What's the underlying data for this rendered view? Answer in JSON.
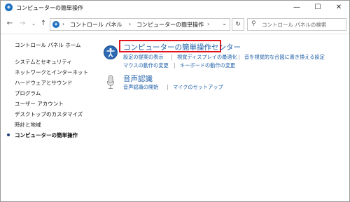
{
  "window": {
    "title": "コンピューターの簡単操作"
  },
  "addressbar": {
    "crumbs": [
      "コントロール パネル",
      "コンピューターの簡単操作"
    ]
  },
  "search": {
    "placeholder": "コントロール パネルの検索"
  },
  "sidebar": {
    "home": "コントロール パネル ホーム",
    "items": [
      {
        "label": "システムとセキュリティ"
      },
      {
        "label": "ネットワークとインターネット"
      },
      {
        "label": "ハードウェアとサウンド"
      },
      {
        "label": "プログラム"
      },
      {
        "label": "ユーザー アカウント"
      },
      {
        "label": "デスクトップのカスタマイズ"
      },
      {
        "label": "時計と地域"
      },
      {
        "label": "コンピューターの簡単操作"
      }
    ]
  },
  "main": {
    "ease": {
      "title": "コンピューターの簡単操作センター",
      "links": [
        "設定の提案の表示",
        "視覚ディスプレイの最適化",
        "音を視覚的な合図に置き換える設定",
        "マウスの動作の変更",
        "キーボードの動作の変更"
      ]
    },
    "speech": {
      "title": "音声認識",
      "links": [
        "音声認識の開始",
        "マイクのセットアップ"
      ]
    }
  },
  "colors": {
    "link": "#1f5fa8",
    "highlight": "#e0141d"
  }
}
